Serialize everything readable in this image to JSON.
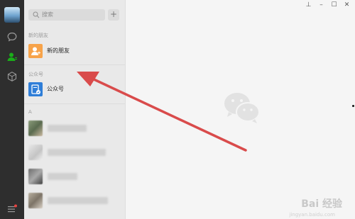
{
  "search": {
    "placeholder": "搜索"
  },
  "list": {
    "add_label": "+",
    "sections": {
      "new_friends_header": "新的朋友",
      "official_header": "公众号",
      "alpha_header": "A"
    },
    "items": {
      "new_friends": "新的朋友",
      "official_accounts": "公众号"
    }
  },
  "nav": {
    "icons": [
      "avatar",
      "chat-icon",
      "contacts-icon",
      "favorites-cube-icon",
      "menu-icon"
    ]
  },
  "window": {
    "pin": "⊥",
    "minimize": "–",
    "maximize": "☐",
    "close": "✕"
  },
  "watermark": {
    "brand": "Bai 经验",
    "url": "jingyan.baidu.com"
  },
  "colors": {
    "new_friends_icon": "#f7a34a",
    "official_icon": "#2f7ed8",
    "arrow": "#d94b4b",
    "contacts_active": "#1aad19"
  }
}
